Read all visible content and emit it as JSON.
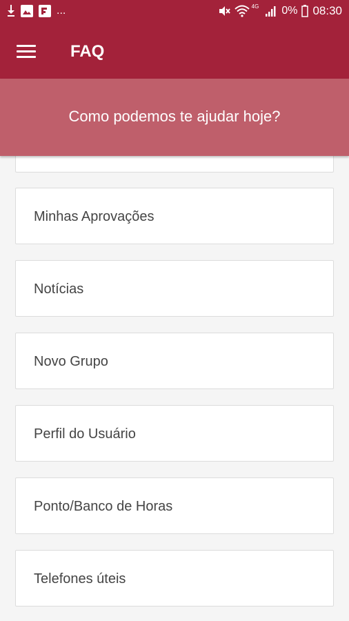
{
  "status_bar": {
    "time": "08:30",
    "battery": "0%",
    "network": "4G",
    "notifications_more": "..."
  },
  "app_bar": {
    "title": "FAQ",
    "menu_icon": "hamburger-menu-icon"
  },
  "banner": {
    "text": "Como podemos te ajudar hoje?"
  },
  "faq_items": [
    {
      "label": ""
    },
    {
      "label": "Minhas Aprovações"
    },
    {
      "label": "Notícias"
    },
    {
      "label": "Novo Grupo"
    },
    {
      "label": "Perfil do Usuário"
    },
    {
      "label": "Ponto/Banco de Horas"
    },
    {
      "label": "Telefones úteis"
    }
  ],
  "colors": {
    "primary": "#a3223a",
    "banner": "#bf5f6b",
    "background": "#f5f5f5",
    "card": "#ffffff"
  }
}
